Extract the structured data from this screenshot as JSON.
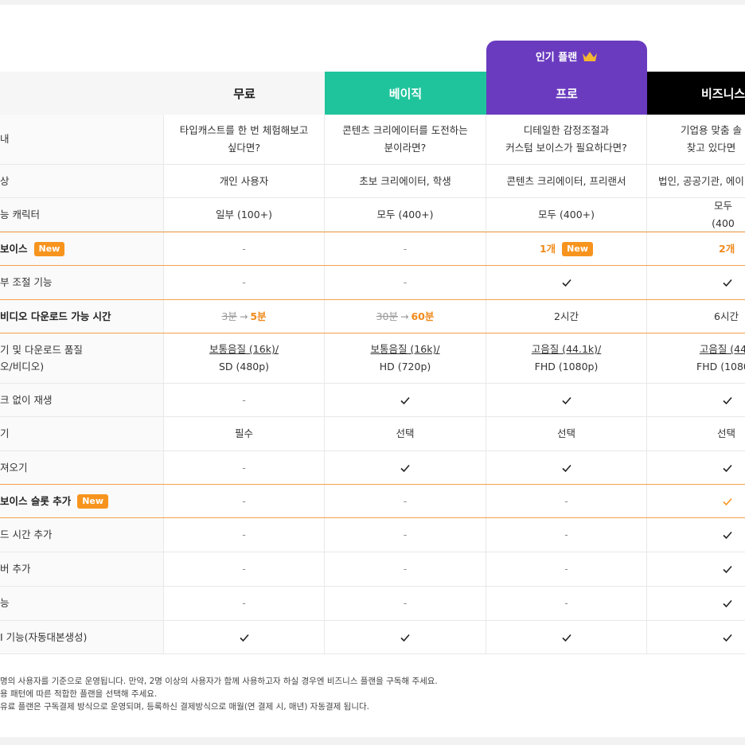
{
  "popular_badge": "인기 플랜",
  "plans": {
    "free": "무료",
    "basic": "베이직",
    "pro": "프로",
    "biz": "비즈니스"
  },
  "rows": [
    {
      "label": "내",
      "free": "타입캐스트를 한 번 체험해보고\n싶다면?",
      "basic": "콘텐츠 크리에이터를 도전하는\n분이라면?",
      "pro": "디테일한 감정조절과\n커스텀 보이스가 필요하다면?",
      "biz": "기업용 맞춤 솔\n찾고 있다면"
    },
    {
      "label": "상",
      "free": "개인 사용자",
      "basic": "초보 크리에이터, 학생",
      "pro": "콘텐츠 크리에이터, 프리랜서",
      "biz": "법인, 공공기관, 에이"
    },
    {
      "label": "능 캐릭터",
      "free": "일부 (100+)",
      "basic": "모두 (400+)",
      "pro": "모두 (400+)",
      "biz": "모두 (400"
    },
    {
      "label": "보이스",
      "badge": "New",
      "free": "-",
      "basic": "-",
      "pro": "1개",
      "pro_badge": "New",
      "biz": "2개"
    },
    {
      "label": "부 조절 기능",
      "free": "-",
      "basic": "-",
      "pro": "check",
      "biz": "check"
    },
    {
      "label": "비디오 다운로드 가능 시간",
      "free_old": "3분",
      "free_new": "5분",
      "basic_old": "30분",
      "basic_new": "60분",
      "pro": "2시간",
      "biz": "6시간"
    },
    {
      "label": "기 및 다운로드 품질\n오/비디오)",
      "free": "보통음질 (16k)/",
      "free2": "SD (480p)",
      "basic": "보통음질 (16k)/",
      "basic2": "HD (720p)",
      "pro": "고음질 (44.1k)/",
      "pro2": "FHD (1080p)",
      "biz": "고음질 (44",
      "biz2": "FHD (1080"
    },
    {
      "label": "크 없이 재생",
      "free": "-",
      "basic": "check",
      "pro": "check",
      "biz": "check"
    },
    {
      "label": "기",
      "free": "필수",
      "basic": "선택",
      "pro": "선택",
      "biz": "선택"
    },
    {
      "label": "져오기",
      "free": "-",
      "basic": "check",
      "pro": "check",
      "biz": "check"
    },
    {
      "label": "보이스 슬롯 추가",
      "badge": "New",
      "free": "-",
      "basic": "-",
      "pro": "-",
      "biz": "check-orange"
    },
    {
      "label": "드 시간 추가",
      "free": "-",
      "basic": "-",
      "pro": "-",
      "biz": "check"
    },
    {
      "label": "버 추가",
      "free": "-",
      "basic": "-",
      "pro": "-",
      "biz": "check"
    },
    {
      "label": "능",
      "free": "-",
      "basic": "-",
      "pro": "-",
      "biz": "check"
    },
    {
      "label": "I 기능(자동대본생성)",
      "free": "check",
      "basic": "check",
      "pro": "check",
      "biz": "check"
    }
  ],
  "arrow": "→",
  "notes": [
    "명의 사용자를 기준으로 운영됩니다. 만약, 2명 이상의 사용자가 함께 사용하고자 하실 경우엔 비즈니스 플랜을 구독해 주세요.",
    "용 패턴에 따른 적합한 플랜을 선택해 주세요.",
    "유료 플랜은 구독결제 방식으로 운영되며, 등록하신 결제방식으로 매월(연 결제 시, 매년) 자동결제 됩니다."
  ],
  "colors": {
    "basic": "#1fc49c",
    "pro": "#6a3bbf",
    "biz": "#000000",
    "accent": "#f7941d"
  }
}
